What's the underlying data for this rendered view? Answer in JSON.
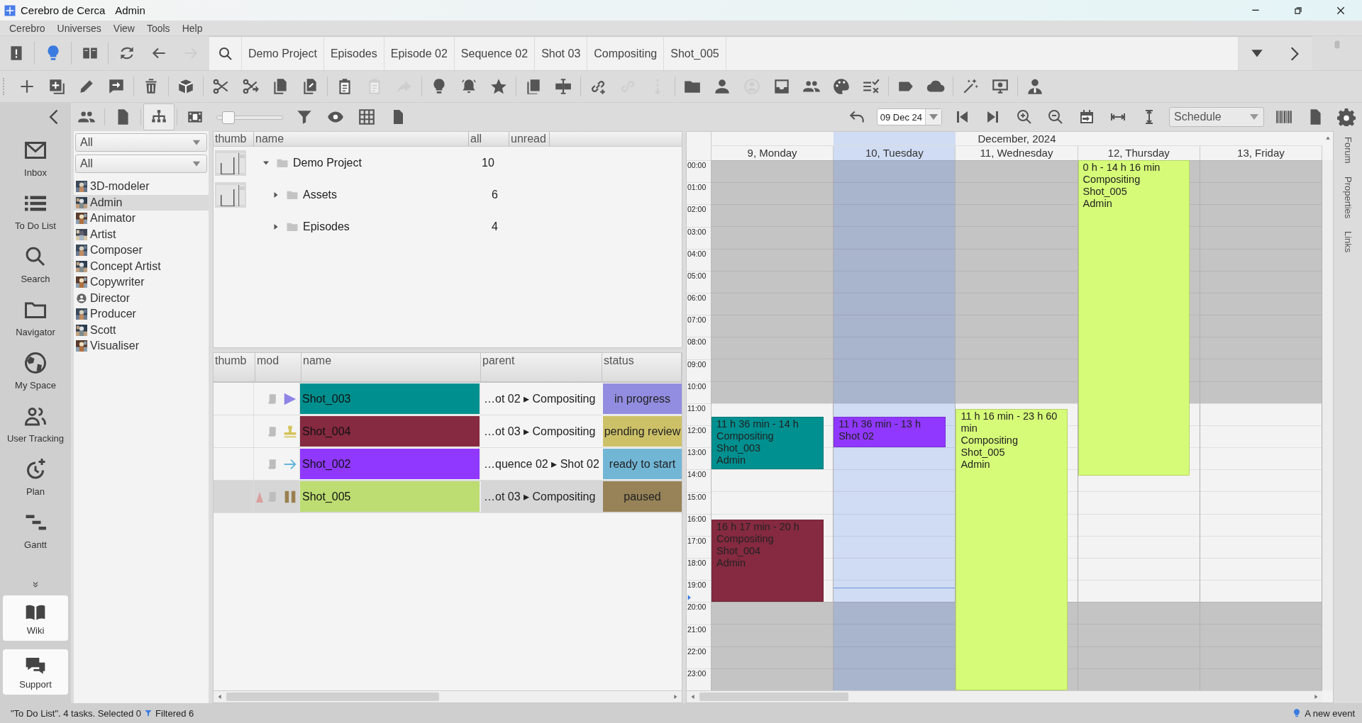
{
  "window": {
    "app": "Cerebro de Cerca",
    "user": "Admin"
  },
  "menu": [
    "Cerebro",
    "Universes",
    "View",
    "Tools",
    "Help"
  ],
  "toolbar1": [
    {
      "disabled": false
    },
    {
      "disabled": false
    },
    {
      "disabled": false
    },
    {
      "disabled": false
    },
    {
      "disabled": false
    },
    {
      "disabled": true
    }
  ],
  "breadcrumbs": [
    "Demo Project",
    "Episodes",
    "Episode 02",
    "Sequence 02",
    "Shot 03",
    "Compositing",
    "Shot_005"
  ],
  "toolbar2": [
    {
      "disabled": false
    },
    {
      "disabled": false
    },
    {
      "disabled": false
    },
    {
      "disabled": false
    },
    {
      "disabled": false
    },
    {
      "disabled": false
    },
    {
      "disabled": false
    },
    {
      "disabled": false
    },
    {
      "disabled": false
    },
    {
      "disabled": false
    },
    {
      "disabled": false
    },
    {
      "disabled": true
    },
    {
      "disabled": true
    },
    {
      "disabled": false
    },
    {
      "disabled": false
    },
    {
      "disabled": false
    },
    {
      "disabled": false
    },
    {
      "disabled": false
    },
    {
      "disabled": false
    },
    {
      "disabled": true
    },
    {
      "disabled": true
    },
    {
      "disabled": false
    },
    {
      "disabled": false
    },
    {
      "disabled": true
    },
    {
      "disabled": false
    },
    {
      "disabled": false
    },
    {
      "disabled": false
    },
    {
      "disabled": false
    },
    {
      "disabled": false
    },
    {
      "disabled": false
    },
    {
      "disabled": false
    },
    {
      "disabled": false
    },
    {
      "disabled": false
    }
  ],
  "toolbar3": [
    {
      "selected": false
    },
    {
      "selected": false
    },
    {
      "selected": true
    },
    {
      "selected": false
    }
  ],
  "thumb_size": {
    "level": 0.15
  },
  "nav": {
    "items": [
      "Inbox",
      "To Do List",
      "Search",
      "Navigator",
      "My Space",
      "User Tracking",
      "Plan",
      "Gantt"
    ],
    "bottom": [
      "Wiki",
      "Support"
    ]
  },
  "filters": [
    "All",
    "All"
  ],
  "roles": [
    {
      "name": "3D-modeler",
      "selected": false
    },
    {
      "name": "Admin",
      "selected": true
    },
    {
      "name": "Animator",
      "selected": false
    },
    {
      "name": "Artist",
      "selected": false
    },
    {
      "name": "Composer",
      "selected": false
    },
    {
      "name": "Concept Artist",
      "selected": false
    },
    {
      "name": "Copywriter",
      "selected": false
    },
    {
      "name": "Director",
      "selected": false
    },
    {
      "name": "Producer",
      "selected": false
    },
    {
      "name": "Scott",
      "selected": false
    },
    {
      "name": "Visualiser",
      "selected": false
    }
  ],
  "tree": {
    "columns": [
      "thumb",
      "name",
      "all",
      "unread"
    ],
    "rows": [
      {
        "name": "Demo Project",
        "all": "10",
        "expanded": true,
        "thumb": {
          "kind": "picture"
        },
        "children": [
          {
            "name": "Assets",
            "all": "6",
            "expanded": false,
            "thumb": {
              "kind": "picture"
            }
          },
          {
            "name": "Episodes",
            "all": "4",
            "expanded": false
          }
        ]
      }
    ]
  },
  "tasks": {
    "columns": [
      "thumb",
      "mod",
      "name",
      "parent",
      "status"
    ],
    "rows": [
      {
        "kind": "progress",
        "name": "Shot_003",
        "color": "#008f8f",
        "parent": "…ot 02 ▸ Compositing",
        "status": {
          "label": "in progress",
          "color": "#928de0"
        },
        "flagged": false,
        "selected": false
      },
      {
        "kind": "review",
        "name": "Shot_004",
        "color": "#852a40",
        "parent": "…ot 03 ▸ Compositing",
        "status": {
          "label": "pending review",
          "color": "#cdc168"
        },
        "flagged": false,
        "selected": false
      },
      {
        "kind": "ready",
        "name": "Shot_002",
        "color": "#9038ff",
        "parent": "…quence 02 ▸ Shot 02",
        "status": {
          "label": "ready to start",
          "color": "#72b6d6"
        },
        "flagged": false,
        "selected": false
      },
      {
        "kind": "paused",
        "name": "Shot_005",
        "color": "#bddd72",
        "parent": "…ot 03 ▸ Compositing",
        "status": {
          "label": "paused",
          "color": "#978357"
        },
        "flagged": true,
        "selected": true
      }
    ]
  },
  "calendar": {
    "date": "09 Dec 24",
    "view": "Schedule",
    "month": "December, 2024",
    "hours": [
      "00:00",
      "01:00",
      "02:00",
      "03:00",
      "04:00",
      "05:00",
      "06:00",
      "07:00",
      "08:00",
      "09:00",
      "10:00",
      "11:00",
      "12:00",
      "13:00",
      "14:00",
      "15:00",
      "16:00",
      "17:00",
      "18:00",
      "19:00",
      "20:00",
      "21:00",
      "22:00",
      "23:00"
    ],
    "days": [
      {
        "label": "9, Monday",
        "selected": false,
        "events": [
          {
            "color": "#009090",
            "lines": [
              "11 h 36 min - 14 h",
              "Compositing",
              "Shot_003",
              "Admin"
            ]
          },
          {
            "color": "#852a40",
            "lines": [
              "16 h 17 min - 20 h",
              "Compositing",
              "Shot_004",
              "Admin"
            ]
          }
        ]
      },
      {
        "label": "10, Tuesday",
        "selected": true,
        "events": [
          {
            "color": "#9038ff",
            "lines": [
              "11 h 36 min - 13 h",
              "Shot 02"
            ]
          }
        ]
      },
      {
        "label": "11, Wednesday",
        "selected": false,
        "events": [
          {
            "color": "#d6fb78",
            "lines": [
              "11 h 16 min - 23 h 60 min",
              "Compositing",
              "Shot_005",
              "Admin"
            ]
          }
        ]
      },
      {
        "label": "12, Thursday",
        "selected": false,
        "events": [
          {
            "color": "#d6fb78",
            "lines": [
              "0 h - 14 h 16 min",
              "Compositing",
              "Shot_005",
              "Admin"
            ]
          }
        ]
      },
      {
        "label": "13, Friday",
        "selected": false
      }
    ]
  },
  "side_tabs": [
    "Forum",
    "Properties",
    "Links"
  ],
  "status_bar": {
    "text": "\"To Do List\". 4 tasks. Selected 0",
    "filtered": "Filtered 6",
    "event": "A new event"
  }
}
